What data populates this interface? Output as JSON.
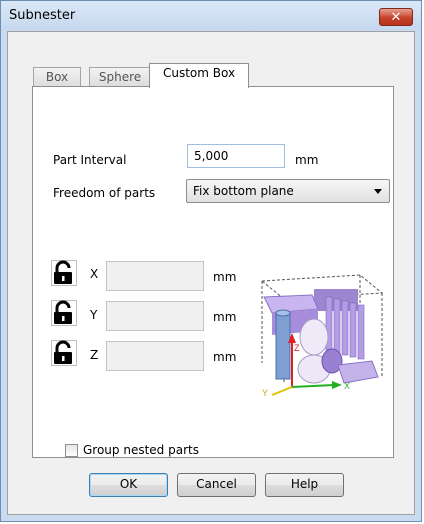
{
  "window": {
    "title": "Subnester",
    "close_symbol": "✕"
  },
  "tabs": [
    {
      "label": "Box",
      "active": false
    },
    {
      "label": "Sphere",
      "active": false
    },
    {
      "label": "Custom Box",
      "active": true
    }
  ],
  "form": {
    "part_interval_label": "Part Interval",
    "part_interval_value": "5,000",
    "part_interval_unit": "mm",
    "freedom_label": "Freedom of parts",
    "freedom_value": "Fix bottom plane"
  },
  "axes": [
    {
      "label": "X",
      "value": "",
      "unit": "mm",
      "locked": true
    },
    {
      "label": "Y",
      "value": "",
      "unit": "mm",
      "locked": true
    },
    {
      "label": "Z",
      "value": "",
      "unit": "mm",
      "locked": true
    }
  ],
  "preview": {
    "axis_x": "X",
    "axis_y": "Y",
    "axis_z": "Z"
  },
  "group_nested_label": "Group nested parts",
  "group_nested_checked": false,
  "buttons": {
    "ok": "OK",
    "cancel": "Cancel",
    "help": "Help"
  },
  "colors": {
    "titlebar": "#c9dbef",
    "close": "#c6422b",
    "part": "#a78bd6"
  }
}
